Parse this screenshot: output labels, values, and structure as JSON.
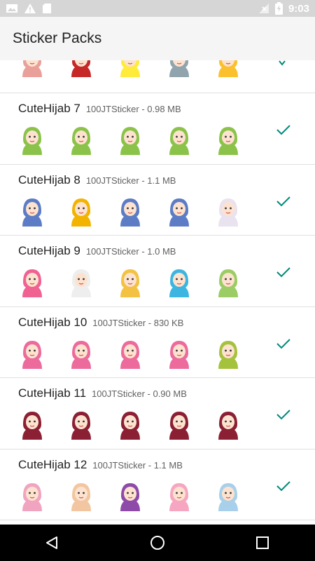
{
  "status_bar": {
    "time": "9:03",
    "icons": [
      "photo-icon",
      "warning-icon",
      "sd-card-icon",
      "no-signal-icon",
      "battery-charging-icon"
    ]
  },
  "app_bar": {
    "title": "Sticker Packs"
  },
  "colors": {
    "accent": "#00897b",
    "divider": "#e0e0e0",
    "status_bar": "#d6d6d6",
    "nav_bar": "#000000"
  },
  "packs": [
    {
      "name": "CuteHijab 7",
      "publisher": "100JTSticker",
      "size": "0.98 MB",
      "added": true,
      "palette": [
        "#8bc34a",
        "#8bc34a",
        "#8bc34a",
        "#8bc34a",
        "#8bc34a"
      ]
    },
    {
      "name": "CuteHijab 8",
      "publisher": "100JTSticker",
      "size": "1.1 MB",
      "added": true,
      "palette": [
        "#5c7cc6",
        "#f2b400",
        "#5c7cc6",
        "#5c7cc6",
        "#e9e2ef"
      ]
    },
    {
      "name": "CuteHijab 9",
      "publisher": "100JTSticker",
      "size": "1.0 MB",
      "added": true,
      "palette": [
        "#f06292",
        "#eeeeee",
        "#f3c242",
        "#3cb6e0",
        "#9ccc65"
      ]
    },
    {
      "name": "CuteHijab 10",
      "publisher": "100JTSticker",
      "size": "830 KB",
      "added": true,
      "palette": [
        "#ec6a9c",
        "#ec6a9c",
        "#ec6a9c",
        "#ec6a9c",
        "#a5c23d"
      ]
    },
    {
      "name": "CuteHijab 11",
      "publisher": "100JTSticker",
      "size": "0.90 MB",
      "added": true,
      "palette": [
        "#8b1f33",
        "#8b1f33",
        "#8b1f33",
        "#8b1f33",
        "#8b1f33"
      ]
    },
    {
      "name": "CuteHijab 12",
      "publisher": "100JTSticker",
      "size": "1.1 MB",
      "added": true,
      "palette": [
        "#f0a4c0",
        "#f2c6a0",
        "#8e4aa8",
        "#f6a6c1",
        "#a8d0ea"
      ]
    }
  ],
  "partial_pack": {
    "palette": [
      "#e9a09a",
      "#c62828",
      "#ffeb3b",
      "#90a4ae",
      "#fbc02d"
    ]
  },
  "nav": [
    "back-icon",
    "home-icon",
    "recents-icon"
  ]
}
